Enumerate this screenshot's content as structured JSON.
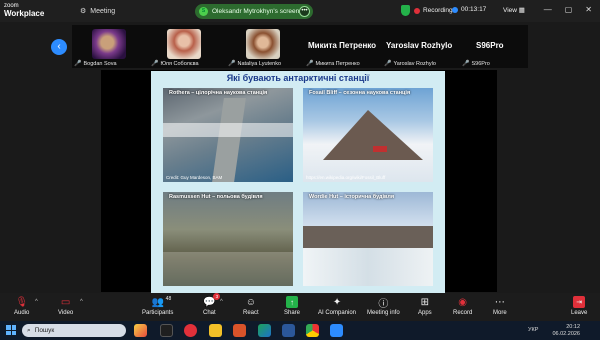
{
  "app": {
    "logo_line1": "zoom",
    "logo_line2": "Workplace"
  },
  "topbar": {
    "meeting_label": "Meeting",
    "screen_share_label": "Oleksandr Mytrokhyn's screen",
    "recording_label": "Recording",
    "timer": "00:13:17",
    "view_label": "View"
  },
  "gallery": [
    {
      "name": "Bogdan Sova"
    },
    {
      "name": "Юля Соболєва"
    },
    {
      "name": "Nataliya Lyutenko"
    },
    {
      "display": "Микита Петренко",
      "name": "Микита Петренко"
    },
    {
      "display": "Yaroslav Rozhylo",
      "name": "Yaroslav Rozhylo"
    },
    {
      "display": "S96Pro",
      "name": "S96Pro"
    }
  ],
  "slide": {
    "title": "Які бувають антарктичні станції",
    "photos": [
      {
        "caption": "Rothera – цілорічна наукова станція",
        "credit": "Credit: Guy Mardeson, BAM"
      },
      {
        "caption": "Fosail Bliff – сезонна наукова станція",
        "credit": "https://en.wikipedia.org/wiki/Fossil_Bluff"
      },
      {
        "caption": "Rasmussen Hut – польова будівля",
        "credit": ""
      },
      {
        "caption": "Wordie Hut – історична будівля",
        "credit": ""
      }
    ]
  },
  "toolbar": {
    "audio": "Audio",
    "video": "Video",
    "participants": "Participants",
    "participants_count": "48",
    "chat": "Chat",
    "chat_badge": "3",
    "react": "React",
    "share": "Share",
    "ai_companion": "AI Companion",
    "meeting_info": "Meeting info",
    "apps": "Apps",
    "record": "Record",
    "more": "More",
    "leave": "Leave"
  },
  "taskbar": {
    "search_placeholder": "Пошук",
    "language": "УКР",
    "time": "20:12",
    "date": "06.02.2026"
  },
  "colors": {
    "accent": "#2d8cff",
    "share": "#24b24a",
    "record": "#e0303a",
    "leave": "#e0303a"
  }
}
